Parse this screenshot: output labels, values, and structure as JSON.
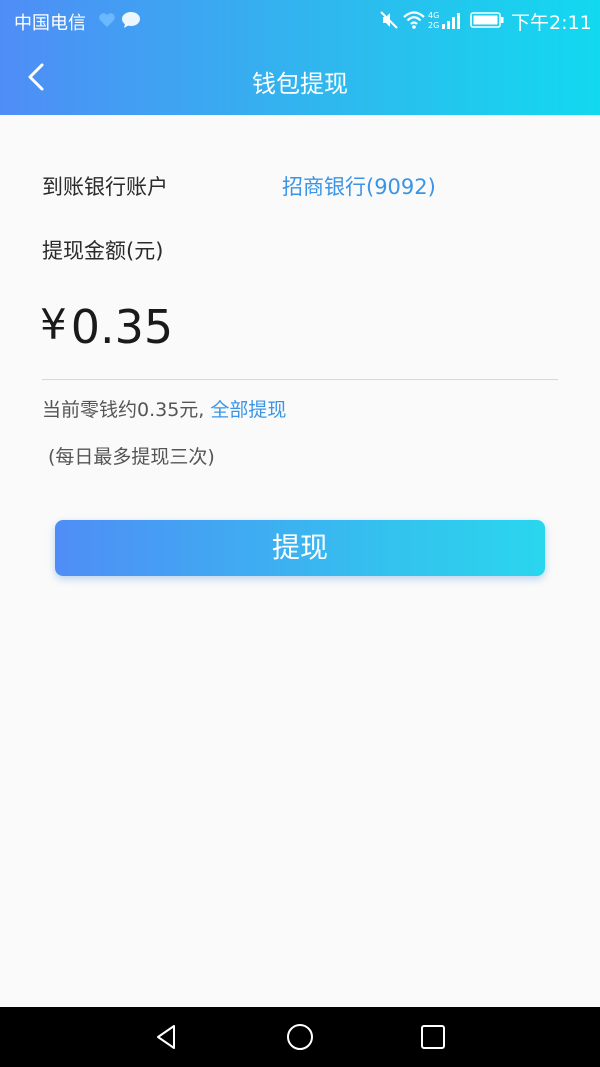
{
  "status_bar": {
    "carrier": "中国电信",
    "time": "下午2:11",
    "network_label_top": "4G",
    "network_label_bottom": "2G",
    "icons": [
      "heart-icon",
      "message-icon",
      "mute-icon",
      "wifi-icon",
      "signal-icon",
      "battery-icon"
    ]
  },
  "header": {
    "title": "钱包提现",
    "back_icon": "chevron-left-icon"
  },
  "form": {
    "bank_label": "到账银行账户",
    "bank_value": "招商银行(9092)",
    "amount_label": "提现金额(元)",
    "currency_symbol": "¥",
    "amount_value": "0.35",
    "balance_prefix": "当前零钱约0.35元, ",
    "withdraw_all_label": "全部提现",
    "limit_note": "(每日最多提现三次)",
    "submit_label": "提现"
  },
  "system_nav": {
    "icons": [
      "triangle-back-icon",
      "circle-home-icon",
      "square-recents-icon"
    ]
  },
  "colors": {
    "accent": "#3a95e6",
    "gradient_start": "#4f8df6",
    "gradient_end": "#12d9ef",
    "background": "#fafafa"
  }
}
